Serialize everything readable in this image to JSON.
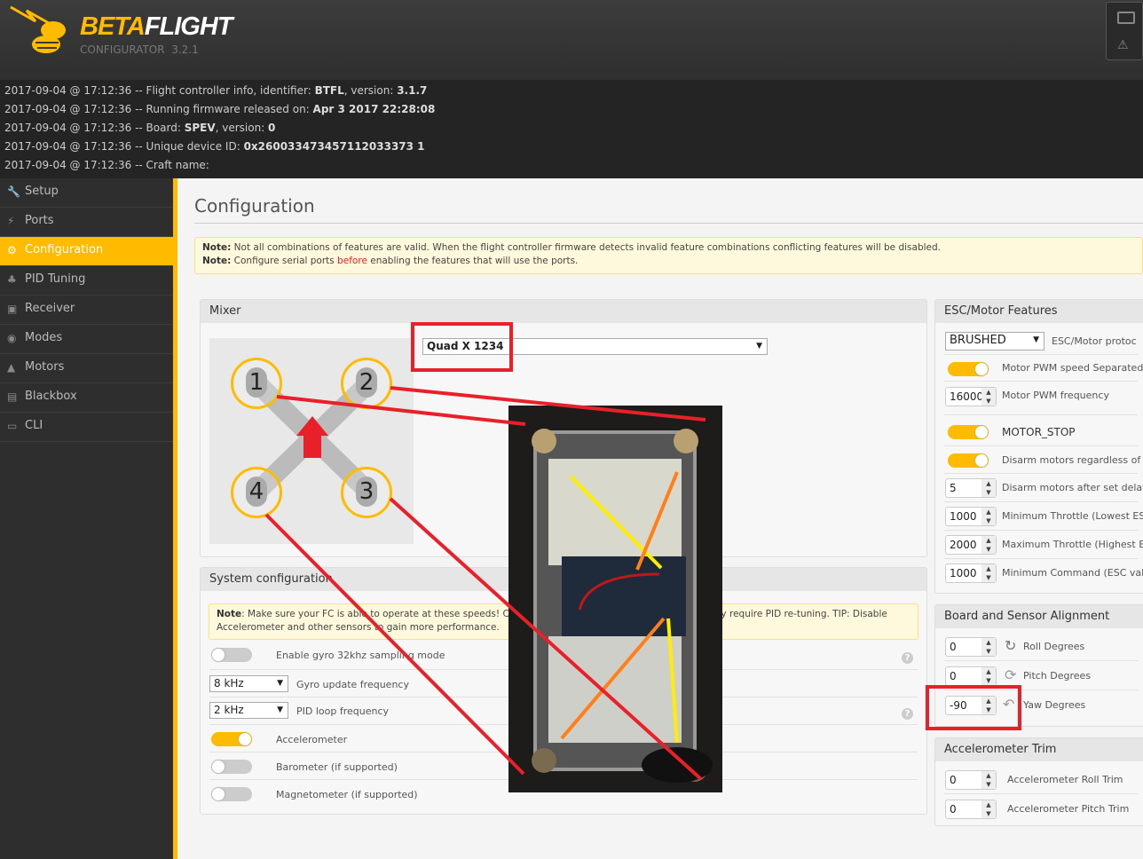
{
  "app": {
    "brand_beta": "BETA",
    "brand_flight": "FLIGHT",
    "subtitle": "CONFIGURATOR  3.2.1"
  },
  "log": [
    {
      "prefix": "2017-09-04 @ 17:12:36 -- Flight controller info, identifier: ",
      "b1": "BTFL",
      "mid": ", version: ",
      "b2": "3.1.7"
    },
    {
      "prefix": "2017-09-04 @ 17:12:36 -- Running firmware released on: ",
      "b1": "Apr 3 2017 22:28:08",
      "mid": "",
      "b2": ""
    },
    {
      "prefix": "2017-09-04 @ 17:12:36 -- Board: ",
      "b1": "SPEV",
      "mid": ", version: ",
      "b2": "0"
    },
    {
      "prefix": "2017-09-04 @ 17:12:36 -- Unique device ID: ",
      "b1": "0x260033473457112033373 1",
      "mid": "",
      "b2": ""
    },
    {
      "prefix": "2017-09-04 @ 17:12:36 -- Craft name:",
      "b1": "",
      "mid": "",
      "b2": ""
    }
  ],
  "sidebar": [
    {
      "label": "Setup",
      "icon": "wrench-icon",
      "glyph": "🔧"
    },
    {
      "label": "Ports",
      "icon": "plug-icon",
      "glyph": "⚡"
    },
    {
      "label": "Configuration",
      "icon": "gear-icon",
      "glyph": "⚙",
      "active": true
    },
    {
      "label": "PID Tuning",
      "icon": "sitemap-icon",
      "glyph": "♣"
    },
    {
      "label": "Receiver",
      "icon": "receiver-icon",
      "glyph": "▣"
    },
    {
      "label": "Modes",
      "icon": "toggle-icon",
      "glyph": "◉"
    },
    {
      "label": "Motors",
      "icon": "motor-icon",
      "glyph": "▲"
    },
    {
      "label": "Blackbox",
      "icon": "blackbox-icon",
      "glyph": "▤"
    },
    {
      "label": "CLI",
      "icon": "terminal-icon",
      "glyph": "▭"
    }
  ],
  "page": {
    "title": "Configuration",
    "note1_b": "Note:",
    "note1": " Not all combinations of features are valid. When the flight controller firmware detects invalid feature combinations conflicting features will be disabled.",
    "note2_b": "Note:",
    "note2_a": " Configure serial ports ",
    "note2_link": "before",
    "note2_c": " enabling the features that will use the ports."
  },
  "mixer": {
    "title": "Mixer",
    "selected": "Quad X 1234",
    "motors": [
      "1",
      "2",
      "3",
      "4"
    ]
  },
  "system": {
    "title": "System configuration",
    "note_b": "Note",
    "note": ": Make sure your FC is able to operate at these speeds! Che",
    "note_right": "ay require PID re-tuning. TIP: Disable",
    "note2": "Accelerometer and other sensors to gain more performance.",
    "gyro32": {
      "label": "Enable gyro 32khz sampling mode",
      "on": false
    },
    "gyro_freq": {
      "value": "8 kHz",
      "label": "Gyro update frequency"
    },
    "pid_freq": {
      "value": "2 kHz",
      "label": "PID loop frequency"
    },
    "acc": {
      "label": "Accelerometer",
      "on": true
    },
    "baro": {
      "label": "Barometer (if supported)",
      "on": false
    },
    "mag": {
      "label": "Magnetometer (if supported)",
      "on": false
    }
  },
  "esc": {
    "title": "ESC/Motor Features",
    "protocol": "BRUSHED",
    "protocol_label": "ESC/Motor protoc",
    "pwm_sep": "Motor PWM speed Separated",
    "pwm_freq_val": "16000",
    "pwm_freq": "Motor PWM frequency",
    "motor_stop": "MOTOR_STOP",
    "disarm_regardless": "Disarm motors regardless of",
    "disarm_delay_val": "5",
    "disarm_delay": "Disarm motors after set delay",
    "min_thr_val": "1000",
    "min_thr": "Minimum Throttle (Lowest ES",
    "max_thr_val": "2000",
    "max_thr": "Maximum Throttle (Highest E",
    "min_cmd_val": "1000",
    "min_cmd": "Minimum Command (ESC val"
  },
  "align": {
    "title": "Board and Sensor Alignment",
    "roll_val": "0",
    "roll": "Roll Degrees",
    "pitch_val": "0",
    "pitch": "Pitch Degrees",
    "yaw_val": "-90",
    "yaw": "Yaw Degrees"
  },
  "trim": {
    "title": "Accelerometer Trim",
    "roll_val": "0",
    "roll": "Accelerometer Roll Trim",
    "pitch_val": "0",
    "pitch": "Accelerometer Pitch Trim"
  },
  "colors": {
    "accent": "#ffbb00",
    "annotation": "#e8202a"
  }
}
